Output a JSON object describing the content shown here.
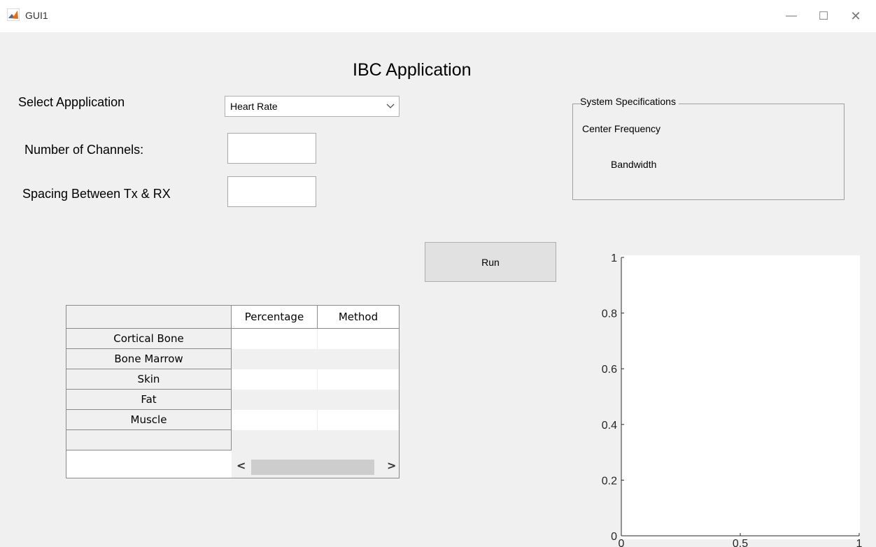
{
  "window": {
    "title": "GUI1",
    "minimize": "—",
    "maximize": "☐",
    "close": "✕"
  },
  "form": {
    "heading": "IBC Application",
    "select_label": "Select Appplication",
    "select_value": "Heart Rate",
    "channels_label": "Number of Channels:",
    "channels_value": "",
    "spacing_label": "Spacing Between Tx & RX",
    "spacing_value": "",
    "run_label": "Run"
  },
  "specs": {
    "legend": "System Specifications",
    "center_frequency_label": "Center Frequency",
    "bandwidth_label": "Bandwidth"
  },
  "table": {
    "columns": [
      "",
      "Percentage",
      "Method"
    ],
    "rows": [
      "Cortical Bone",
      "Bone Marrow",
      "Skin",
      "Fat",
      "Muscle",
      ""
    ],
    "scroll_left": "<",
    "scroll_right": ">"
  },
  "chart_data": {
    "type": "line",
    "x_ticks": [
      "0",
      "0.5",
      "1"
    ],
    "y_ticks": [
      "0",
      "0.2",
      "0.4",
      "0.6",
      "0.8",
      "1"
    ],
    "xlim": [
      0,
      1
    ],
    "ylim": [
      0,
      1
    ],
    "series": []
  }
}
